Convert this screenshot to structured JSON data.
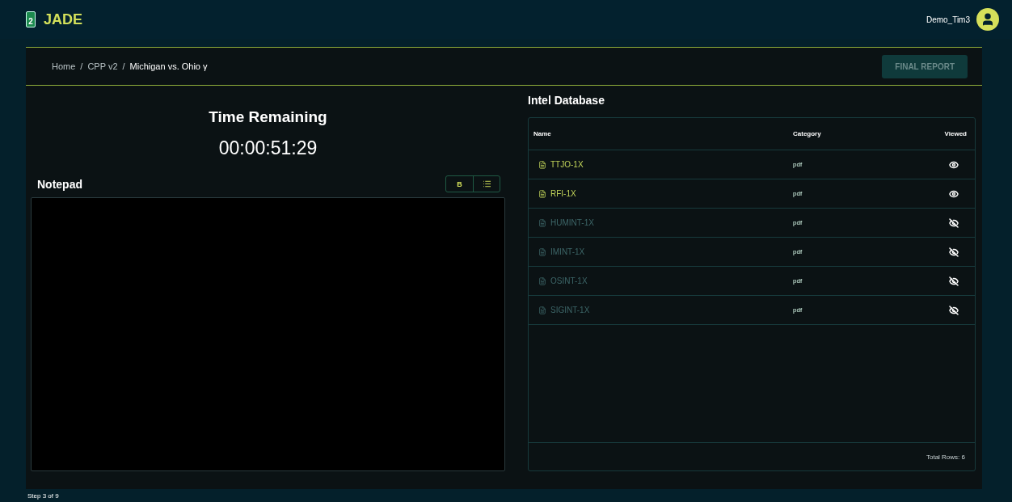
{
  "header": {
    "logo_badge": "2",
    "title": "JADE",
    "user": "Demo_Tim3"
  },
  "breadcrumb": [
    {
      "label": "Home",
      "current": false
    },
    {
      "label": "CPP v2",
      "current": false
    },
    {
      "label": "Michigan vs. Ohio γ",
      "current": true
    }
  ],
  "breadcrumb_separator": "/",
  "final_report_button": {
    "label": "FINAL REPORT",
    "disabled": true
  },
  "timer": {
    "title": "Time Remaining",
    "value": "00:00:51:29"
  },
  "notepad": {
    "title": "Notepad",
    "bold_button": "B"
  },
  "intel": {
    "title": "Intel Database",
    "columns": [
      "Name",
      "Category",
      "Viewed"
    ],
    "rows": [
      {
        "name": "TTJO-1X",
        "category": "pdf",
        "viewed": true
      },
      {
        "name": "RFI-1X",
        "category": "pdf",
        "viewed": true
      },
      {
        "name": "HUMINT-1X",
        "category": "pdf",
        "viewed": false
      },
      {
        "name": "IMINT-1X",
        "category": "pdf",
        "viewed": false
      },
      {
        "name": "OSINT-1X",
        "category": "pdf",
        "viewed": false
      },
      {
        "name": "SIGINT-1X",
        "category": "pdf",
        "viewed": false
      }
    ],
    "total": "Total Rows: 6"
  },
  "status_bar": "Step 3 of 9"
}
